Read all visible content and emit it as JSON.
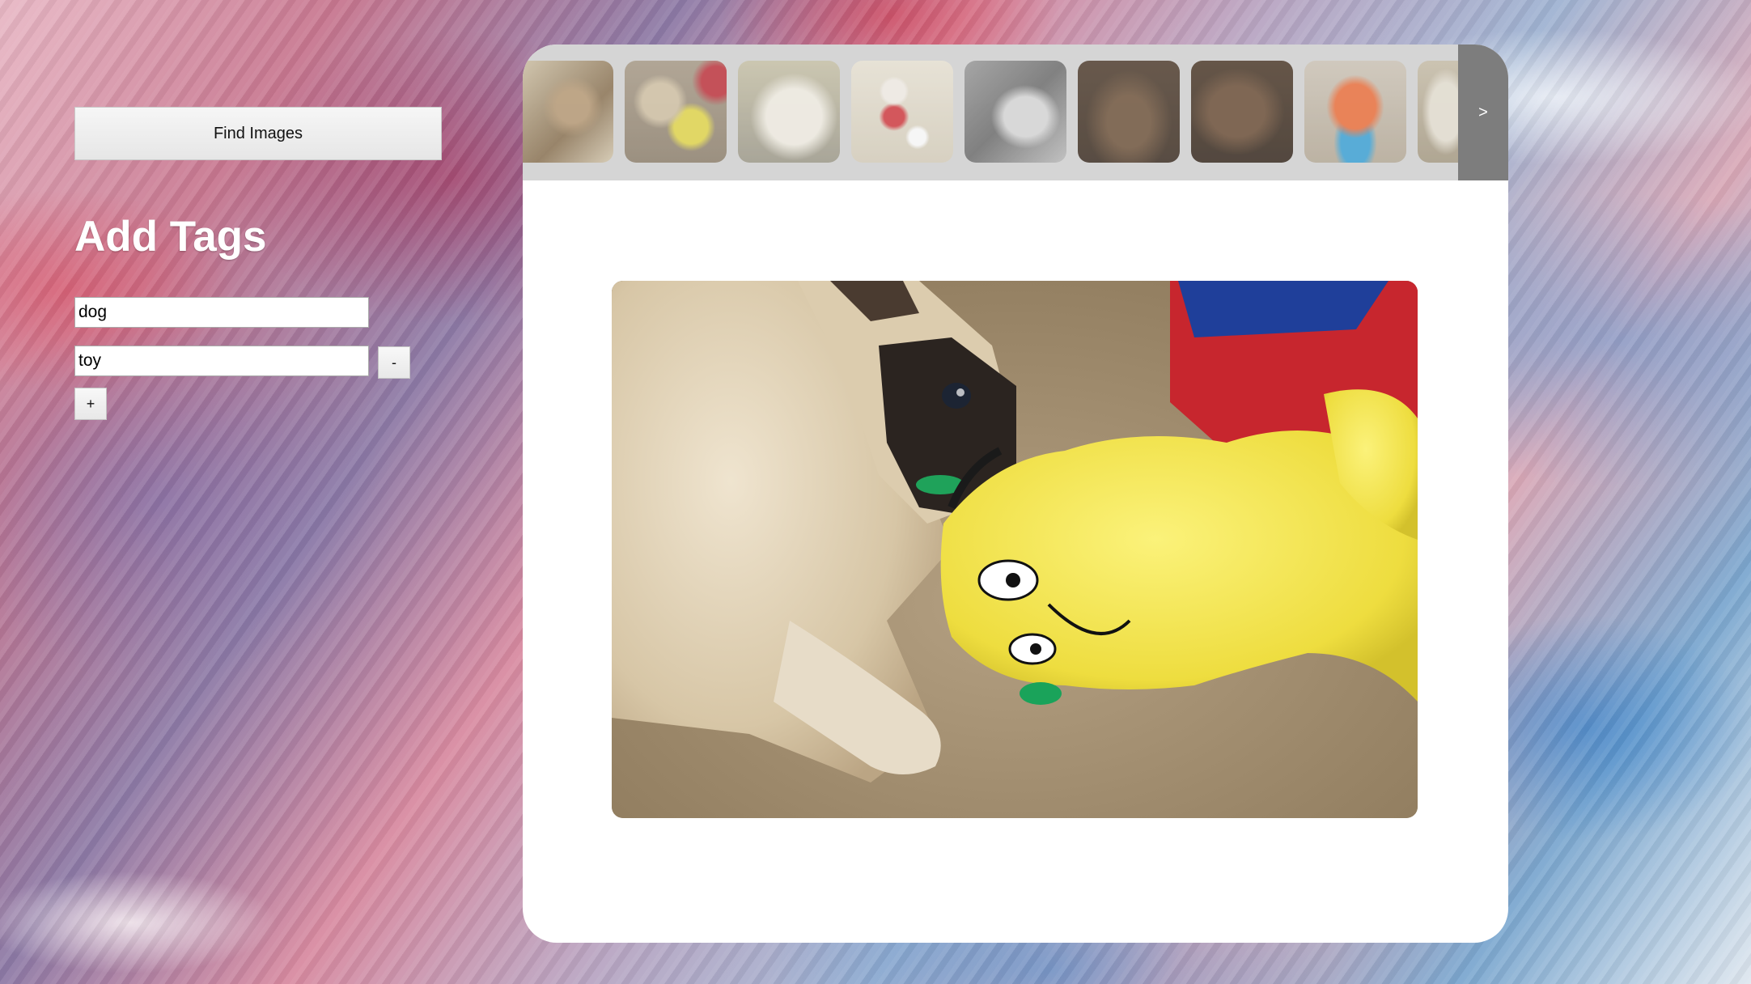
{
  "sidebar": {
    "find_images_label": "Find Images",
    "heading": "Add Tags",
    "tags": [
      "dog",
      "toy"
    ],
    "remove_label": "-",
    "add_label": "+"
  },
  "gallery": {
    "next_label": ">",
    "thumbnails": [
      "dog on blanket",
      "pug with yellow toy",
      "white fluffy dog",
      "doll figurine with white dog",
      "dog in grass (black and white)",
      "brown fluffy dog",
      "brown dog sleeping",
      "orange rubber toy",
      "partial thumbnail"
    ],
    "main_image": "pug chewing yellow plush toy"
  },
  "colors": {
    "panel_bg": "#ffffff",
    "strip_bg": "#d5d5d5",
    "next_button_bg": "#7d7d7d",
    "heading_color": "#ffffff"
  }
}
